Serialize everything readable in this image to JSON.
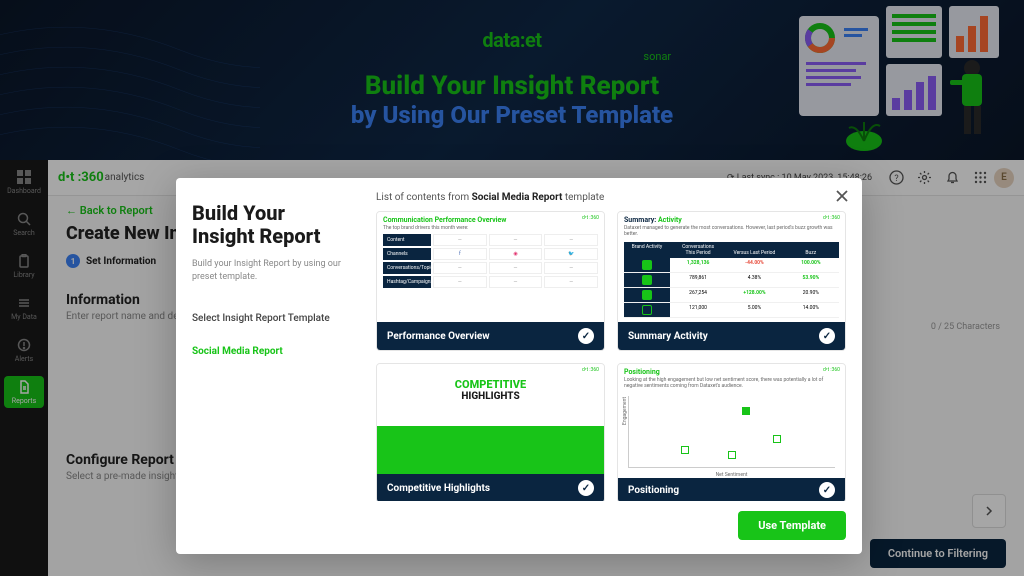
{
  "hero": {
    "logo": "data:et",
    "logo_sub": "sonar",
    "title": "Build Your Insight Report",
    "subtitle": "by Using Our Preset Template"
  },
  "sidebar": {
    "items": [
      {
        "label": "Dashboard"
      },
      {
        "label": "Search"
      },
      {
        "label": "Library"
      },
      {
        "label": "My Data"
      },
      {
        "label": "Alerts"
      },
      {
        "label": "Reports"
      }
    ]
  },
  "topbar": {
    "brand": "d•t :360",
    "brand_sub": "analytics",
    "sync": "Last sync : 10 May 2023, 15:48:26",
    "avatar": "E"
  },
  "page": {
    "back": "←  Back to Report",
    "title": "Create New Insight",
    "step1": "Set Information",
    "info_h": "Information",
    "info_p": "Enter report name and description.",
    "char_count": "0 / 25 Characters",
    "config_h": "Configure Report",
    "config_p": "Select a pre-made insight report template by clicking \"Browse Template\".",
    "continue": "Continue to Filtering"
  },
  "modal": {
    "title_l1": "Build Your",
    "title_l2": "Insight Report",
    "desc": "Build your Insight Report by using our preset template.",
    "tpl_label": "Select Insight Report Template",
    "tpl_selected": "Social Media Report",
    "list_prefix": "List of contents from ",
    "list_bold": "Social Media Report",
    "list_suffix": " template",
    "use_btn": "Use Template",
    "cards": [
      {
        "label": "Performance Overview"
      },
      {
        "label": "Summary Activity"
      },
      {
        "label": "Competitive Highlights"
      },
      {
        "label": "Positioning"
      }
    ]
  },
  "preview": {
    "perf": {
      "title": "Communication Performance Overview",
      "sub": "The top brand drivers this month were:",
      "tag": "d•t :360",
      "rows": [
        "Content",
        "Channels",
        "Conversations/Topic",
        "Hashtag/Campaigns"
      ]
    },
    "summary": {
      "title": "Summary: Activity",
      "sub": "Dataxet managed to generate the most conversations. However, last period's buzz growth was better.",
      "head": [
        "Brand Activity",
        "This Period",
        "Versus Last Period",
        "Buzz"
      ],
      "rows": [
        [
          "1,328,136",
          "-44.00%",
          "100.00%"
        ],
        [
          "789,861",
          "4.38%",
          "53.90%"
        ],
        [
          "267,254",
          "+128.00%",
          "20.90%"
        ],
        [
          "121,000",
          "5.00%",
          "14.00%"
        ]
      ]
    },
    "comp": {
      "title": "COMPETITIVE",
      "sub": "HIGHLIGHTS"
    },
    "pos": {
      "title": "Positioning",
      "sub": "Looking at the high engagement but low net sentiment score, there was potentially a lot of negative sentiments coming from Dataxet's audience.",
      "xlabel": "Net Sentiment",
      "ylabel": "Engagement"
    }
  }
}
